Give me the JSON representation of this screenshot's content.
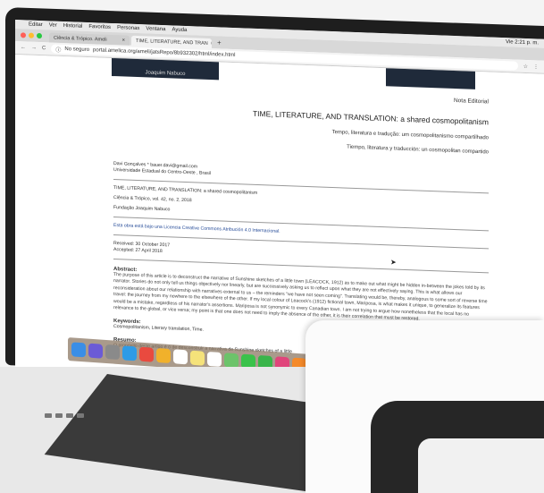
{
  "menubar": {
    "items": [
      "Editar",
      "Ver",
      "Historial",
      "Favoritos",
      "Personas",
      "Ventana",
      "Ayuda"
    ],
    "clock": "Vie 2:21 p. m."
  },
  "tabs": [
    {
      "label": "Ciência & Trópico. Ameli",
      "active": false
    },
    {
      "label": "TIME, LITERATURE, AND TRAN",
      "active": true
    }
  ],
  "address": {
    "security": "No seguro",
    "url": "portal.amelica.org/ameli/jatsRepo/8b932302/html/index.html"
  },
  "header": {
    "left_banner_text": "Joaquim Nabuco"
  },
  "article": {
    "section": "Nota Editorial",
    "title": "TIME, LITERATURE, AND TRANSLATION: a shared cosmopolitanism",
    "title_pt": "Tempo, literatura e tradução: um cosmopolitanismo compartilhado",
    "title_es": "Tiempo, literatura y traducción: un cosmopolitan compartido",
    "author_line": "Davi Gonçalves * bauer.davi@gmail.com",
    "affiliation": "Universidade Estadual do Centro-Oeste , Brasil",
    "ref_title": "TIME, LITERATURE, AND TRANSLATION: a shared cosmopolitanism",
    "journal": "Ciência & Trópico, vol. 42, no. 2, 2018",
    "publisher": "Fundação Joaquim Nabuco",
    "license": "Esta obra está bajo una Licencia Creative Commons Atribución 4.0 Internacional.",
    "received": "Received: 30 October 2017",
    "accepted": "Accepted: 27 April 2018",
    "abstract_heading": "Abstract:",
    "abstract_text": "The purpose of this article is to deconstruct the narrative of Sunshine sketches of a little town (LEACOCK, 1912) as to make out what might be hidden in-between the jokes told by its narrator. Stories do not only tell us things objectively nor linearly, but are successively asking us to reflect upon what they are not effectively saying. This is what allows our reconsideration about our relationship with narratives external to us – the reminders \"we have not seen coming\". Translating would be, thereby, analogous to some sort of reverse time travel: the journey from my nowhere to the elsewhere of the other. If my local colour of Leacock's (1912) fictional town, Mariposa, is what makes it unique, to generalize its features would be a mistake, regardless of his narrator's assertions. Mariposa is not synonymic to every Canadian town. I am not trying to argue how nonetheless that the local has no relevance to the global, or vice versa; my point is that one does not need to imply the absence of the other, it is their correlation that must be restored.",
    "keywords_heading": "Keywords:",
    "keywords": "Cosmopolitanism, Literary translation, Time.",
    "resumo_heading": "Resumo:",
    "resumo_text": "O propósito deste artigo é o de desconstruir a narrativa de Sunshine sketches of a little"
  },
  "colors": {
    "traffic_red": "#ff5f57",
    "traffic_yellow": "#febc2e",
    "traffic_green": "#28c840",
    "banner": "#1f2a3a",
    "link": "#2a4f9a"
  },
  "dock_icons": [
    "finder-icon",
    "siri-icon",
    "launchpad-icon",
    "safari-icon",
    "chrome-icon",
    "photos-icon",
    "calendar-icon",
    "notes-icon",
    "reminders-icon",
    "maps-icon",
    "messages-icon",
    "facetime-icon",
    "itunes-icon",
    "ibooks-icon",
    "appstore-icon",
    "preferences-icon"
  ]
}
